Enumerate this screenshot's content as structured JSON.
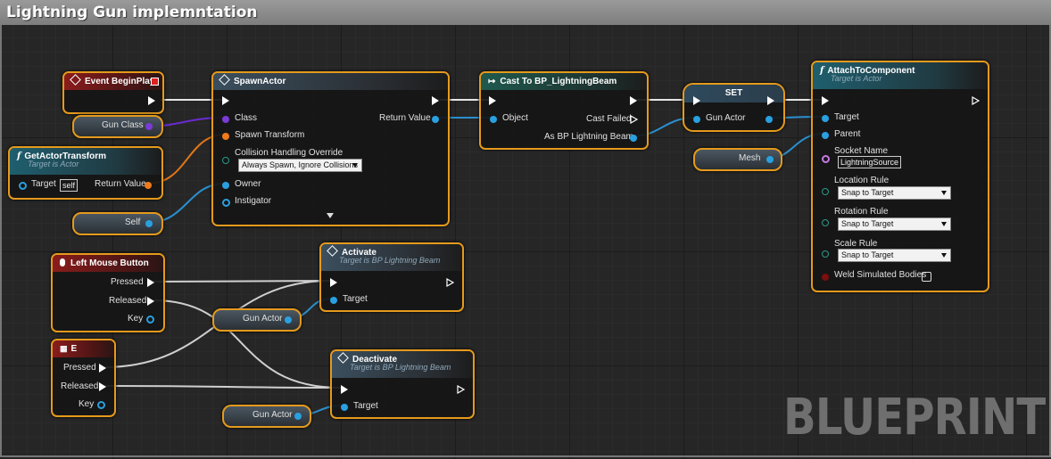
{
  "window_title": "Lightning Gun implemntation",
  "watermark": "BLUEPRINT",
  "nodes": {
    "event_begin_play": {
      "title": "Event BeginPlay"
    },
    "spawn_actor": {
      "title": "SpawnActor",
      "class_label": "Class",
      "spawn_transform_label": "Spawn Transform",
      "collision_label": "Collision Handling Override",
      "collision_value": "Always Spawn, Ignore Collisions",
      "owner_label": "Owner",
      "instigator_label": "Instigator",
      "return_label": "Return Value"
    },
    "get_actor_transform": {
      "title": "GetActorTransform",
      "subtitle": "Target is Actor",
      "target_label": "Target",
      "target_value": "self",
      "return_label": "Return Value"
    },
    "cast": {
      "title": "Cast To BP_LightningBeam",
      "object_label": "Object",
      "cast_failed_label": "Cast Failed",
      "as_label": "As BP Lightning Beam"
    },
    "set": {
      "title": "SET",
      "var_label": "Gun Actor"
    },
    "attach": {
      "title": "AttachToComponent",
      "subtitle": "Target is Actor",
      "target_label": "Target",
      "parent_label": "Parent",
      "socket_label": "Socket Name",
      "socket_value": "LightningSource",
      "location_label": "Location Rule",
      "location_value": "Snap to Target",
      "rotation_label": "Rotation Rule",
      "rotation_value": "Snap to Target",
      "scale_label": "Scale Rule",
      "scale_value": "Snap to Target",
      "weld_label": "Weld Simulated Bodies"
    },
    "left_mouse": {
      "title": "Left Mouse Button",
      "pressed": "Pressed",
      "released": "Released",
      "key": "Key"
    },
    "key_e": {
      "title": "E",
      "pressed": "Pressed",
      "released": "Released",
      "key": "Key"
    },
    "activate": {
      "title": "Activate",
      "subtitle": "Target is BP Lightning Beam",
      "target_label": "Target"
    },
    "deactivate": {
      "title": "Deactivate",
      "subtitle": "Target is BP Lightning Beam",
      "target_label": "Target"
    }
  },
  "variables": {
    "gun_class": "Gun Class",
    "self": "Self",
    "mesh": "Mesh",
    "gun_actor_1": "Gun Actor",
    "gun_actor_2": "Gun Actor"
  },
  "colors": {
    "node_border": "#e59a1c",
    "object_pin": "#29a0e0",
    "class_pin": "#7a3bd6",
    "struct_pin": "#f07a1c",
    "exec_wire": "#e8e8e8",
    "name_pin": "#c77ae6",
    "bool_pin": "#8a1010"
  }
}
